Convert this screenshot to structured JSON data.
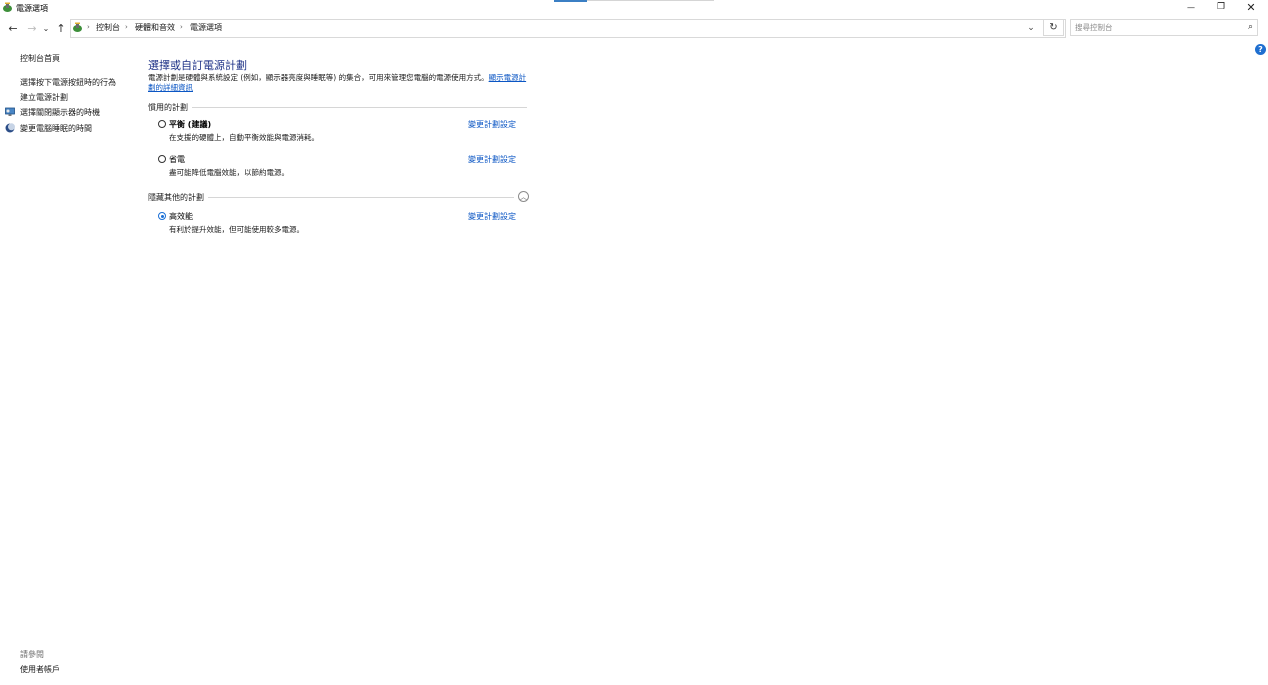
{
  "window": {
    "title": "電源選項",
    "minimize_glyph": "—",
    "restore_glyph": "❐",
    "close_glyph": "✕"
  },
  "nav": {
    "back_glyph": "←",
    "forward_glyph": "→",
    "recent_glyph": "⌄",
    "up_glyph": "↑",
    "dropdown_glyph": "⌄",
    "refresh_glyph": "↻",
    "sep_glyph": "›",
    "breadcrumb": [
      "控制台",
      "硬體和音效",
      "電源選項"
    ]
  },
  "search": {
    "placeholder": "搜尋控制台",
    "icon_glyph": "⌕"
  },
  "help_glyph": "?",
  "sidebar": {
    "home": "控制台首頁",
    "items": [
      {
        "label": "選擇按下電源按鈕時的行為",
        "icon": "none"
      },
      {
        "label": "建立電源計劃",
        "icon": "none"
      },
      {
        "label": "選擇關閉顯示器的時機",
        "icon": "monitor-icon"
      },
      {
        "label": "變更電腦睡眠的時間",
        "icon": "moon-icon"
      }
    ],
    "see_also": "請參閱",
    "user_accounts": "使用者帳戶"
  },
  "main": {
    "heading": "選擇或自訂電源計劃",
    "intro_text": "電源計劃是硬體與系統設定 (例如，顯示器亮度與睡眠等) 的集合，可用來管理您電腦的電源使用方式。",
    "intro_link": "顯示電源計劃的詳細資訊",
    "preferred_group": "慣用的計劃",
    "hidden_group": "隱藏其他的計劃",
    "collapse_glyph": "︿",
    "plans": [
      {
        "name": "平衡",
        "suffix": " (建議)",
        "desc": "在支援的硬體上，自動平衡效能與電源消耗。",
        "link": "變更計劃設定",
        "selected": false
      },
      {
        "name": "省電",
        "suffix": "",
        "desc": "盡可能降低電腦效能，以節約電源。",
        "link": "變更計劃設定",
        "selected": false
      },
      {
        "name": "高效能",
        "suffix": "",
        "desc": "有利於提升效能，但可能使用較多電源。",
        "link": "變更計劃設定",
        "selected": true
      }
    ]
  },
  "colors": {
    "accent": "#3b7fc4",
    "heading": "#1e3287",
    "link": "#0b56c4"
  }
}
